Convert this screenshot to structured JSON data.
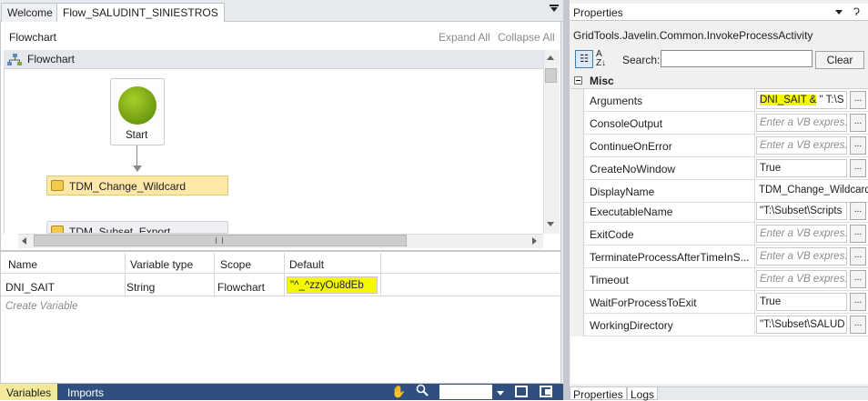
{
  "tabs": [
    {
      "label": "Welcome",
      "active": false
    },
    {
      "label": "Flow_SALUDINT_SINIESTROS",
      "active": true
    }
  ],
  "designer": {
    "breadcrumb": "Flowchart",
    "expand_all": "Expand All",
    "collapse_all": "Collapse All",
    "flowchart_title": "Flowchart",
    "start_label": "Start",
    "activities": [
      "TDM_Change_Wildcard",
      "TDM_Subset_Export"
    ]
  },
  "variables": {
    "headers": [
      "Name",
      "Variable type",
      "Scope",
      "Default"
    ],
    "rows": [
      {
        "name": "DNI_SAIT",
        "type": "String",
        "scope": "Flowchart",
        "default": "\"^_^zzyOu8dEb"
      }
    ],
    "create_placeholder": "Create Variable"
  },
  "bottom_tabs": {
    "variables": "Variables",
    "imports": "Imports"
  },
  "properties": {
    "title": "Properties",
    "pin": "Ɂ",
    "class_name": "GridTools.Javelin.Common.InvokeProcessActivity",
    "search_label": "Search:",
    "search_value": "",
    "clear_label": "Clear",
    "category": "Misc",
    "rows": [
      {
        "name": "Arguments",
        "value_hl": "DNI_SAIT &",
        "value": " \" T:\\S",
        "kind": "box",
        "button": "..."
      },
      {
        "name": "ConsoleOutput",
        "value": "Enter a VB expres:",
        "kind": "placeholder",
        "button": "..."
      },
      {
        "name": "ContinueOnError",
        "value": "Enter a VB expres:",
        "kind": "placeholder",
        "button": "..."
      },
      {
        "name": "CreateNoWindow",
        "value": "True",
        "kind": "box",
        "button": "..."
      },
      {
        "name": "DisplayName",
        "value": "TDM_Change_Wildcard",
        "kind": "plain",
        "button": ""
      },
      {
        "name": "ExecutableName",
        "value": "\"T:\\Subset\\Scripts",
        "kind": "box",
        "button": "..."
      },
      {
        "name": "ExitCode",
        "value": "Enter a VB expres:",
        "kind": "placeholder",
        "button": "..."
      },
      {
        "name": "TerminateProcessAfterTimeInS...",
        "value": "Enter a VB expres:",
        "kind": "placeholder",
        "button": "..."
      },
      {
        "name": "Timeout",
        "value": "Enter a VB expres:",
        "kind": "placeholder",
        "button": "..."
      },
      {
        "name": "WaitForProcessToExit",
        "value": "True",
        "kind": "box",
        "button": "..."
      },
      {
        "name": "WorkingDirectory",
        "value": "\"T:\\Subset\\SALUD",
        "kind": "box",
        "button": "..."
      }
    ],
    "bottom_tabs": [
      "Properties",
      "Logs"
    ]
  }
}
